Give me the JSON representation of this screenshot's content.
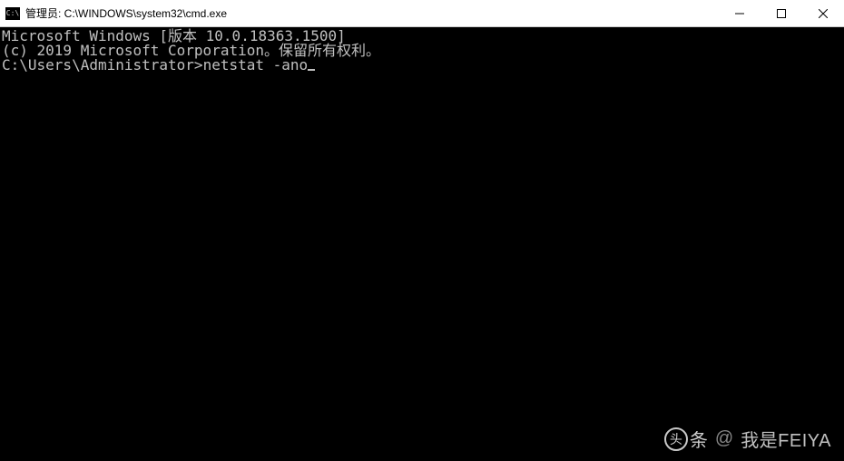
{
  "window": {
    "icon_label": "C:\\",
    "title": "管理员: C:\\WINDOWS\\system32\\cmd.exe"
  },
  "controls": {
    "minimize": "minimize",
    "maximize": "maximize",
    "close": "close"
  },
  "terminal": {
    "line1": "Microsoft Windows [版本 10.0.18363.1500]",
    "line2": "(c) 2019 Microsoft Corporation。保留所有权利。",
    "blank": "",
    "prompt": "C:\\Users\\Administrator>",
    "command": "netstat -ano"
  },
  "watermark": {
    "logo_glyph": "头",
    "logo_text": "条",
    "at": "@",
    "user": "我是FEIYA"
  }
}
